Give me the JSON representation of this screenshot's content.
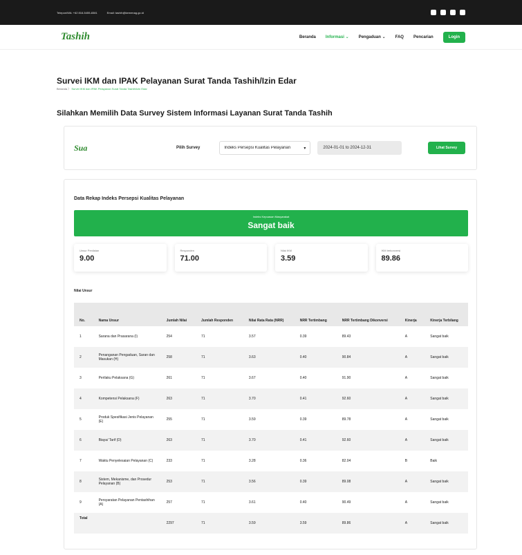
{
  "topbar": {
    "phone": "Telepon/WA: +62 816-5455-8381",
    "email": "Email: tashih@kemenag.go.id",
    "social_icons": [
      "youtube-icon",
      "twitter-icon",
      "instagram-icon",
      "facebook-icon"
    ]
  },
  "navbar": {
    "logo": "Tashih",
    "items": [
      "Beranda",
      "Informasi ⌄",
      "Pengaduan ⌄",
      "FAQ",
      "Pencarian"
    ],
    "active_index": 1,
    "login": "Login"
  },
  "page": {
    "title": "Survei IKM dan IPAK Pelayanan Surat Tanda Tashih/Izin Edar",
    "breadcrumb": [
      "Beranda",
      "Survei IKM dan IPAK Pelayanan Surat Tanda Tashih/Izin Edar"
    ],
    "section_title": "Silahkan Memilih Data Survey Sistem Informasi Layanan Surat Tanda Tashih"
  },
  "selector": {
    "logo": "Sua",
    "pilih_label": "Pilih Survey",
    "selected": "Indeks Persepsi Kualitas Pelayanan",
    "date_range": "2024-01-01 to 2024-12-31",
    "button": "Lihat Survey"
  },
  "rekap": {
    "title": "Data Rekap Indeks Persepsi Kualitas Pelayanan",
    "banner_small": "Indeks Kepuasan Masyarakat",
    "banner_big": "Sangat baik",
    "stats": [
      {
        "label": "Unsur Penilaian",
        "value": "9.00"
      },
      {
        "label": "Responden",
        "value": "71.00"
      },
      {
        "label": "Nilai IKM",
        "value": "3.59"
      },
      {
        "label": "IKM terkonversi",
        "value": "89.86"
      }
    ],
    "nilai_title": "Nilai Unsur"
  },
  "table": {
    "headers": [
      "No.",
      "Nama Unsur",
      "Jumlah Nilai",
      "Jumlah Responden",
      "Nilai Rata Rata (NRR)",
      "NRR Tertimbang",
      "NRR Tertimbang Dikonversi",
      "Kinerja",
      "Kinerja Terbilang"
    ],
    "rows": [
      [
        "1",
        "Sarana dan Prasarana (I)",
        "254",
        "71",
        "3.57",
        "0.39",
        "89.43",
        "A",
        "Sangat baik"
      ],
      [
        "2",
        "Penanganan Pengaduan, Saran dan Masukan (H)",
        "258",
        "71",
        "3.63",
        "0.40",
        "90.84",
        "A",
        "Sangat baik"
      ],
      [
        "3",
        "Perilaku Pelaksana (G)",
        "261",
        "71",
        "3.67",
        "0.40",
        "91.90",
        "A",
        "Sangat baik"
      ],
      [
        "4",
        "Kompetensi Pelaksana (F)",
        "263",
        "71",
        "3.70",
        "0.41",
        "92.60",
        "A",
        "Sangat baik"
      ],
      [
        "5",
        "Produk Spesifikasi Jenis Pelayanan (E)",
        "255",
        "71",
        "3.59",
        "0.39",
        "89.78",
        "A",
        "Sangat baik"
      ],
      [
        "6",
        "Biaya/ Tarif (D)",
        "263",
        "71",
        "3.70",
        "0.41",
        "92.60",
        "A",
        "Sangat baik"
      ],
      [
        "7",
        "Waktu Penyelesaian Pelayanan (C)",
        "233",
        "71",
        "3.28",
        "0.36",
        "82.04",
        "B",
        "Baik"
      ],
      [
        "8",
        "Sistem, Mekanisme, dan Prosedur Pelayanan (B)",
        "253",
        "71",
        "3.56",
        "0.39",
        "89.08",
        "A",
        "Sangat baik"
      ],
      [
        "9",
        "Persyaratan Pelayanan Pentashihan (A)",
        "257",
        "71",
        "3.61",
        "0.40",
        "90.49",
        "A",
        "Sangat baik"
      ]
    ],
    "total": [
      "Total",
      "",
      "2297",
      "71",
      "3.59",
      "3.59",
      "89.86",
      "A",
      "Sangat baik"
    ]
  }
}
